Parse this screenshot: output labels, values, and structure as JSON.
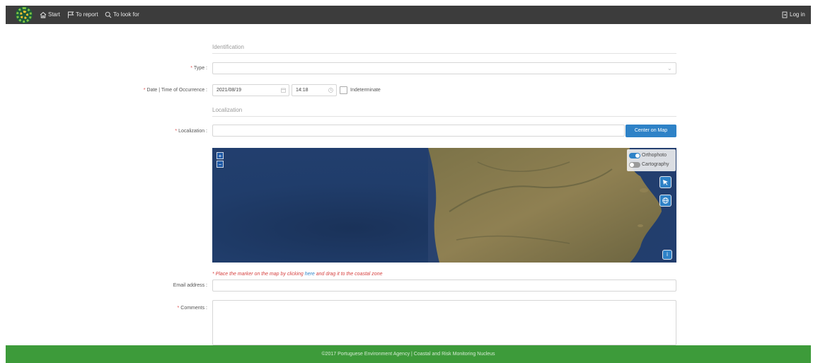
{
  "nav": {
    "start": "Start",
    "to_report": "To report",
    "to_look_for": "To look for",
    "login": "Log in"
  },
  "sections": {
    "identification": "Identification",
    "localization": "Localization"
  },
  "form": {
    "type_label": "Type :",
    "type_value": "",
    "date_time_label": "Date | Time of Occurrence :",
    "date_value": "2021/08/19",
    "time_value": "14:18",
    "indeterminate_label": "Indeterminate",
    "indeterminate_checked": false,
    "localization_label": "Localization :",
    "localization_value": "",
    "center_on_map": "Center on Map",
    "hint_before": "Place the marker on the map by clicking ",
    "hint_link": "here",
    "hint_after": " and drag it to the coastal zone",
    "email_label": "Email address :",
    "email_value": "",
    "comments_label": "Comments :",
    "comments_value": ""
  },
  "map": {
    "zoom_in": "+",
    "zoom_out": "−",
    "layers": [
      {
        "label": "Orthophoto",
        "enabled": true
      },
      {
        "label": "Cartography",
        "enabled": false
      }
    ],
    "tools": [
      "marker-tool-icon",
      "globe-icon",
      "info-icon"
    ],
    "colors": {
      "ocean": "#1f3a66",
      "land": "#8a7a4e",
      "accent": "#2e82c7"
    }
  },
  "footer": {
    "text": "©2017 Portuguese Environment Agency | Coastal and Risk Monitoring Nucleus"
  },
  "colors": {
    "topbar": "#3c3c3c",
    "footer": "#3d9b3a",
    "required": "#e05050",
    "button": "#2e82c7"
  }
}
